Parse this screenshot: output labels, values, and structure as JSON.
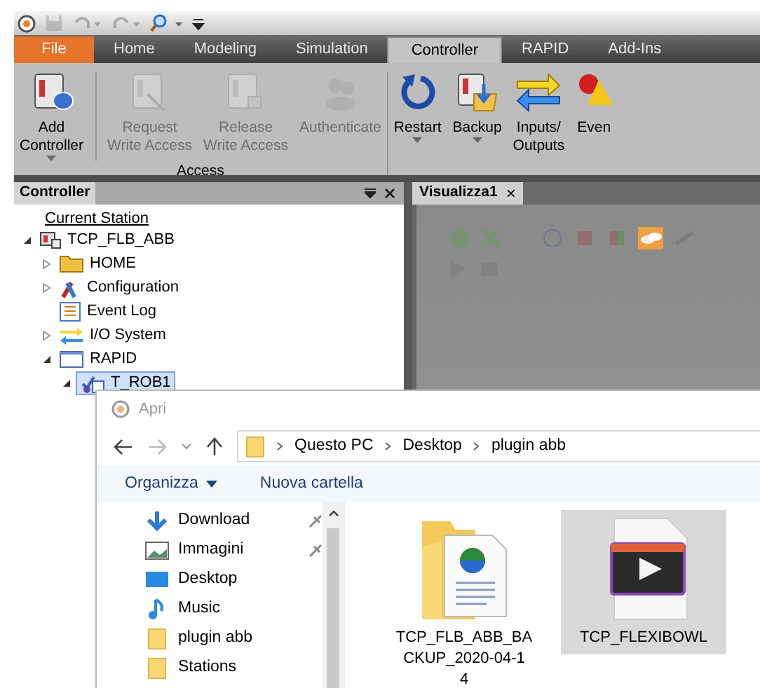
{
  "ribbon_tabs": [
    {
      "label": "File",
      "kind": "file",
      "selected": false
    },
    {
      "label": "Home",
      "kind": "tab",
      "selected": false
    },
    {
      "label": "Modeling",
      "kind": "tab",
      "selected": false
    },
    {
      "label": "Simulation",
      "kind": "tab",
      "selected": false
    },
    {
      "label": "Controller",
      "kind": "tab",
      "selected": true
    },
    {
      "label": "RAPID",
      "kind": "tab",
      "selected": false
    },
    {
      "label": "Add-Ins",
      "kind": "tab",
      "selected": false
    }
  ],
  "ribbon_groups": [
    {
      "label": "Access",
      "buttons": [
        {
          "label": "Add\nController",
          "kind": "controller-add",
          "dropdown": true,
          "disabled": false
        },
        {
          "label": "Request\nWrite Access",
          "kind": "controller",
          "dropdown": false,
          "disabled": true
        },
        {
          "label": "Release\nWrite Access",
          "kind": "controller-lock",
          "dropdown": false,
          "disabled": true
        },
        {
          "label": "Authenticate",
          "kind": "users",
          "dropdown": false,
          "disabled": true
        }
      ]
    },
    {
      "buttons": [
        {
          "label": "Restart",
          "kind": "restart",
          "dropdown": true,
          "disabled": false
        },
        {
          "label": "Backup",
          "kind": "backup",
          "dropdown": true,
          "disabled": false
        },
        {
          "label": "Inputs/\nOutputs",
          "kind": "io",
          "dropdown": false,
          "disabled": false
        },
        {
          "label": "Even",
          "kind": "events",
          "dropdown": false,
          "disabled": false
        }
      ]
    }
  ],
  "controller_pane": {
    "title": "Controller",
    "header": "Current Station",
    "tree": [
      {
        "label": "TCP_FLB_ABB",
        "kind": "station",
        "expandable": true,
        "expanded": true,
        "selected": false,
        "children": [
          {
            "label": "HOME",
            "kind": "folder",
            "expandable": true,
            "expanded": false,
            "selected": false
          },
          {
            "label": "Configuration",
            "kind": "config",
            "expandable": true,
            "expanded": false,
            "selected": false
          },
          {
            "label": "Event Log",
            "kind": "log",
            "expandable": false,
            "selected": false
          },
          {
            "label": "I/O System",
            "kind": "io",
            "expandable": true,
            "expanded": false,
            "selected": false
          },
          {
            "label": "RAPID",
            "kind": "window",
            "expandable": true,
            "expanded": true,
            "selected": false,
            "children": [
              {
                "label": "T_ROB1",
                "kind": "task",
                "expandable": true,
                "expanded": true,
                "selected": true
              }
            ]
          }
        ]
      }
    ]
  },
  "document_tab": {
    "title": "Visualizza1",
    "close": "×"
  },
  "open_dialog": {
    "title": "Apri",
    "breadcrumb": [
      "Questo PC",
      "Desktop",
      "plugin abb"
    ],
    "toolbar": [
      {
        "label": "Organizza",
        "dropdown": true
      },
      {
        "label": "Nuova cartella",
        "dropdown": false
      }
    ],
    "nav_items": [
      {
        "label": "Download",
        "kind": "download",
        "pinned": true
      },
      {
        "label": "Immagini",
        "kind": "pictures",
        "pinned": true
      },
      {
        "label": "Desktop",
        "kind": "desktop",
        "pinned": false
      },
      {
        "label": "Music",
        "kind": "music",
        "pinned": false
      },
      {
        "label": "plugin abb",
        "kind": "folder",
        "pinned": false
      },
      {
        "label": "Stations",
        "kind": "folder",
        "pinned": false
      }
    ],
    "files": [
      {
        "name": "TCP_FLB_ABB_BA\nCKUP_2020-04-1\n4",
        "kind": "folder-web",
        "selected": false
      },
      {
        "name": "TCP_FLEXIBOWL",
        "kind": "video",
        "selected": true
      }
    ]
  }
}
